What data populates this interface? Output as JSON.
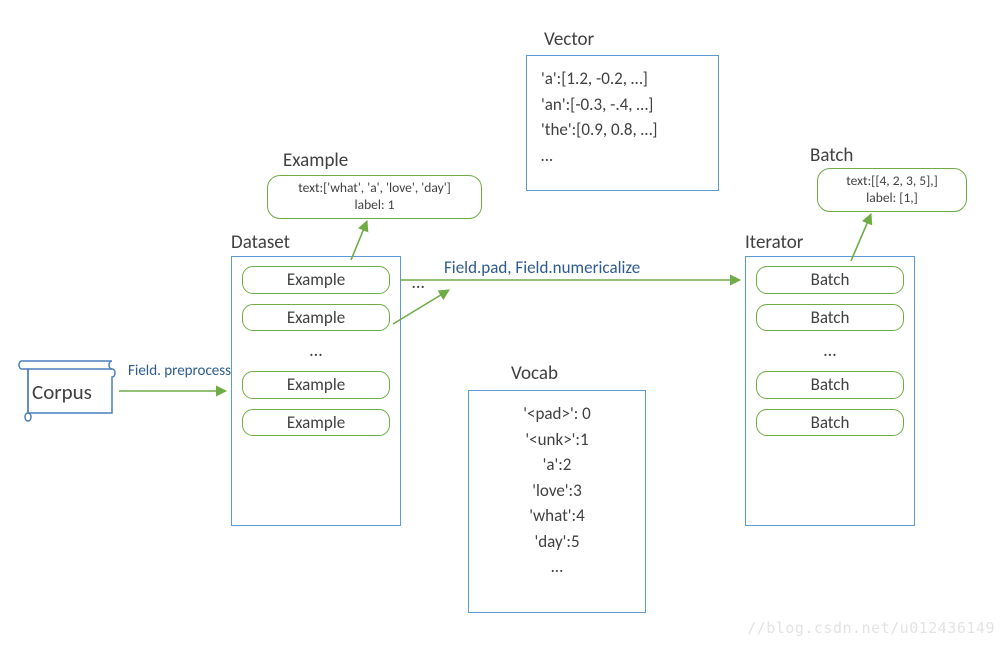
{
  "corpus": {
    "label": "Corpus"
  },
  "dataset": {
    "title": "Dataset",
    "items": [
      "Example",
      "Example",
      "Example",
      "Example"
    ],
    "dots": "…"
  },
  "example_detail": {
    "title": "Example",
    "text_line": "text:['what', 'a', 'love', 'day']",
    "label_line": "label: 1"
  },
  "vector": {
    "title": "Vector",
    "lines": [
      "'a':[1.2, -0.2, …]",
      "'an':[-0.3, -.4, …]",
      "'the':[0.9, 0.8, …]",
      "…"
    ]
  },
  "vocab": {
    "title": "Vocab",
    "lines": [
      "'<pad>': 0",
      "'<unk>':1",
      "'a':2",
      "'love':3",
      "'what':4",
      "'day':5",
      "…"
    ]
  },
  "iterator": {
    "title": "Iterator",
    "items": [
      "Batch",
      "Batch",
      "Batch",
      "Batch"
    ],
    "dots": "…"
  },
  "batch_detail": {
    "title": "Batch",
    "text_line": "text:[[4, 2, 3, 5],]",
    "label_line": "label: [1,]"
  },
  "edges": {
    "preprocess": "Field. preprocess",
    "pad_numericalize": "Field.pad, Field.numericalize"
  },
  "watermark": "//blog.csdn.net/u012436149"
}
